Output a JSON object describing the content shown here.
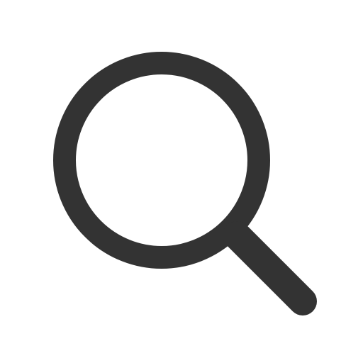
{
  "icon": {
    "name": "search-icon",
    "color": "#333333",
    "background": "#ffffff"
  }
}
